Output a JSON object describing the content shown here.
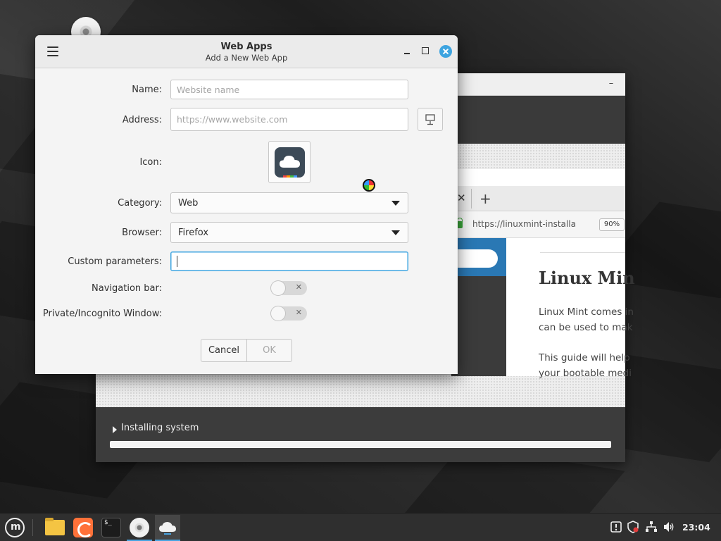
{
  "dialog": {
    "title": "Web Apps",
    "subtitle": "Add a New Web App",
    "fields": {
      "name_label": "Name:",
      "name_placeholder": "Website name",
      "address_label": "Address:",
      "address_placeholder": "https://www.website.com",
      "icon_label": "Icon:",
      "category_label": "Category:",
      "category_value": "Web",
      "browser_label": "Browser:",
      "browser_value": "Firefox",
      "custom_params_label": "Custom parameters:",
      "custom_params_value": "",
      "navbar_label": "Navigation bar:",
      "navbar_on": false,
      "private_label": "Private/Incognito Window:",
      "private_on": false
    },
    "buttons": {
      "cancel": "Cancel",
      "ok": "OK"
    }
  },
  "installer": {
    "browser_url": "https://linuxmint-installa",
    "browser_zoom": "90%",
    "slide_heading": "Linux Min",
    "slide_lines": [
      "Linux Mint comes in",
      "can be used to mak",
      "This guide will help",
      "your bootable medi"
    ],
    "progress_label": "Installing system",
    "progress_fraction": 1.0
  },
  "taskbar": {
    "clock": "23:04",
    "launchers": [
      "menu-icon",
      "folder-icon",
      "firefox-icon",
      "terminal-icon",
      "cd-icon",
      "webapp-icon"
    ]
  },
  "colors": {
    "accent": "#3da4e0",
    "taskbar_bg": "#2f2f2f",
    "dialog_bg": "#f4f4f4"
  }
}
